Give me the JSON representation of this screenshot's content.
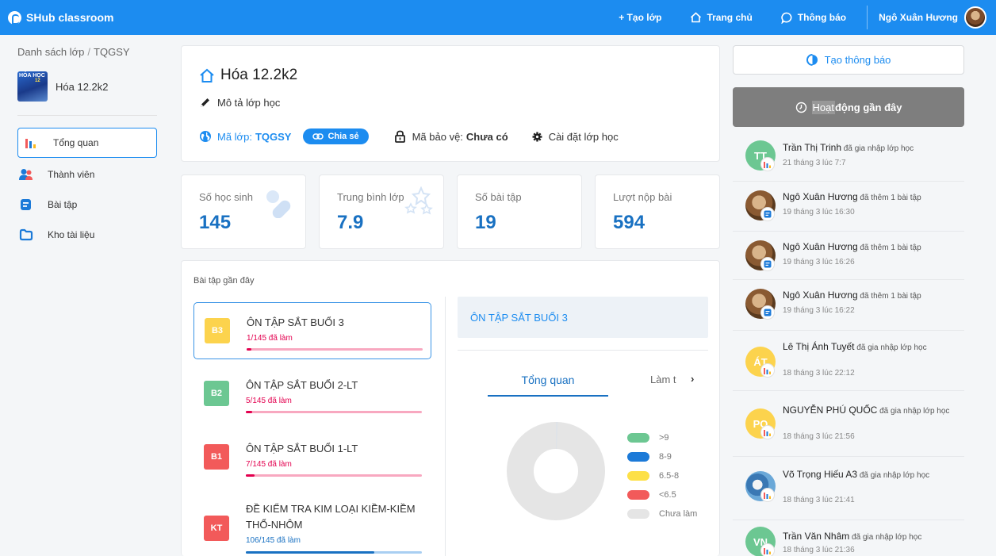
{
  "app": {
    "name": "SHub classroom",
    "brand_color": "#1c8cf0"
  },
  "topnav": {
    "create_class": "+ Tạo lớp",
    "home": "Trang chủ",
    "notifications": "Thông báo",
    "user_name": "Ngô Xuân Hương"
  },
  "breadcrumb": {
    "root": "Danh sách lớp",
    "separator": "/",
    "current": "TQGSY"
  },
  "class_info": {
    "thumb_text": "HÓA HỌC",
    "thumb_num": "12",
    "name": "Hóa 12.2k2"
  },
  "sidebar": {
    "items": [
      {
        "label": "Tổng quan",
        "icon": "bar-chart-icon",
        "active": true
      },
      {
        "label": "Thành viên",
        "icon": "members-icon"
      },
      {
        "label": "Bài tập",
        "icon": "assignment-icon"
      },
      {
        "label": "Kho tài liệu",
        "icon": "folder-icon"
      }
    ]
  },
  "class_card": {
    "title": "Hóa 12.2k2",
    "description": "Mô tả lớp học",
    "code_label": "Mã lớp:",
    "code_value": "TQGSY",
    "share_label": "Chia sẻ",
    "protect_label": "Mã bảo vệ:",
    "protect_value": "Chưa có",
    "settings_label": "Cài đặt lớp học"
  },
  "stats": [
    {
      "label": "Số học sinh",
      "value": "145"
    },
    {
      "label": "Trung bình lớp",
      "value": "7.9"
    },
    {
      "label": "Số bài tập",
      "value": "19"
    },
    {
      "label": "Lượt nộp bài",
      "value": "594"
    }
  ],
  "assignments": {
    "title": "Bài tập gần đây",
    "items": [
      {
        "badge": "B3",
        "badge_color": "#fcd34d",
        "name": "ÔN TẬP SẮT BUỔI 3",
        "count": "1/145 đã làm",
        "progress": 0.007,
        "bar_theme": "pink"
      },
      {
        "badge": "B2",
        "badge_color": "#6cc792",
        "name": "ÔN TẬP SẮT BUỔI 2-LT",
        "count": "5/145 đã làm",
        "progress": 0.034,
        "bar_theme": "pink"
      },
      {
        "badge": "B1",
        "badge_color": "#f25a5a",
        "name": "ÔN TẬP SẮT BUỔI 1-LT",
        "count": "7/145 đã làm",
        "progress": 0.048,
        "bar_theme": "pink"
      },
      {
        "badge": "KT",
        "badge_color": "#f25a5a",
        "name": "ĐỀ KIỂM TRA KIM LOẠI KIỀM-KIỀM THỔ-NHÔM",
        "count": "106/145 đã làm",
        "progress": 0.731,
        "bar_theme": "blue"
      }
    ]
  },
  "detail": {
    "title": "ÔN TẬP SẮT BUỔI 3",
    "tab_overview": "Tổng quan",
    "tab_next": "Làm t",
    "tab_arrow": "›"
  },
  "chart_data": {
    "type": "pie",
    "variant": "donut",
    "categories": [
      ">9",
      "8-9",
      "6.5-8",
      "<6.5",
      "Chưa làm"
    ],
    "values": [
      0,
      0,
      0,
      0,
      144
    ],
    "extra_slice": {
      "count": 1,
      "color": "#dfe3e8"
    },
    "colors": [
      "#6cc792",
      "#1c7ad8",
      "#fde047",
      "#f25a5a",
      "#e5e5e5"
    ],
    "legend_position": "right"
  },
  "right": {
    "create_notice": "Tạo thông báo",
    "activity_title_hl": "Hoạt",
    "activity_title_rest": " động gần đây",
    "activity": [
      {
        "name": "Trần Thị Trinh",
        "action": " đã gia nhập lớp học",
        "time": "21 tháng 3 lúc 7:7",
        "initials": "TT",
        "avatar_color": "#6cc792",
        "kind": "join"
      },
      {
        "name": "Ngô Xuân Hương",
        "action": " đã thêm 1 bài tập",
        "time": "19 tháng 3 lúc 16:30",
        "initials": "",
        "avatar_color": "",
        "kind": "assign"
      },
      {
        "name": "Ngô Xuân Hương",
        "action": " đã thêm 1 bài tập",
        "time": "19 tháng 3 lúc 16:26",
        "initials": "",
        "avatar_color": "",
        "kind": "assign"
      },
      {
        "name": "Ngô Xuân Hương",
        "action": " đã thêm 1 bài tập",
        "time": "19 tháng 3 lúc 16:22",
        "initials": "",
        "avatar_color": "",
        "kind": "assign"
      },
      {
        "name": "Lê Thị Ánh Tuyết",
        "action": " đã gia nhập lớp học",
        "time": "18 tháng 3 lúc 22:12",
        "initials": "ÁT",
        "avatar_color": "#fcd34d",
        "kind": "join"
      },
      {
        "name": "NGUYỄN PHÚ QUỐC",
        "action": " đã gia nhập lớp học",
        "time": "18 tháng 3 lúc 21:56",
        "initials": "PQ",
        "avatar_color": "#fcd34d",
        "kind": "join"
      },
      {
        "name": "Võ Trọng Hiếu A3",
        "action": " đã gia nhập lớp học",
        "time": "18 tháng 3 lúc 21:41",
        "initials": "",
        "avatar_color": "",
        "kind": "join2"
      },
      {
        "name": "Trần Văn Nhâm",
        "action": " đã gia nhập lớp học",
        "time": "18 tháng 3 lúc 21:36",
        "initials": "VN",
        "avatar_color": "#6cc792",
        "kind": "join"
      }
    ]
  }
}
